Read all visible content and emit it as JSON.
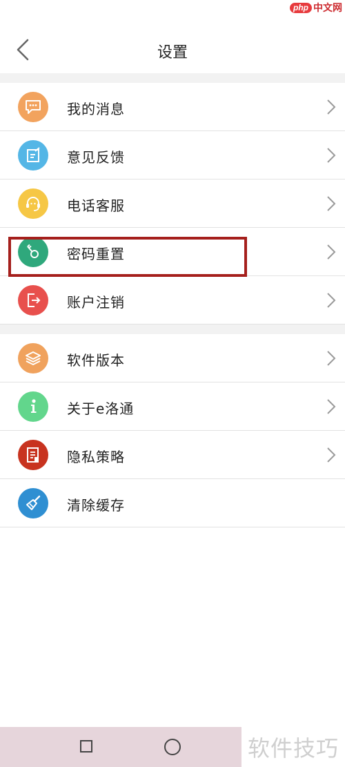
{
  "watermark_top": {
    "badge": "php",
    "text": "中文网"
  },
  "header": {
    "title": "设置"
  },
  "groups": [
    {
      "items": [
        {
          "label": "我的消息",
          "icon": "message-icon",
          "color": "#f2a35e"
        },
        {
          "label": "意见反馈",
          "icon": "feedback-icon",
          "color": "#54b6e6"
        },
        {
          "label": "电话客服",
          "icon": "headset-icon",
          "color": "#f6c745"
        },
        {
          "label": "密码重置",
          "icon": "key-icon",
          "color": "#2fa87c"
        },
        {
          "label": "账户注销",
          "icon": "logout-icon",
          "color": "#e8504d"
        }
      ]
    },
    {
      "items": [
        {
          "label": "软件版本",
          "icon": "layers-icon",
          "color": "#f0a25d"
        },
        {
          "label": "关于e洛通",
          "icon": "info-icon",
          "color": "#62d68c"
        },
        {
          "label": "隐私策略",
          "icon": "document-icon",
          "color": "#c8331f"
        },
        {
          "label": "清除缓存",
          "icon": "broom-icon",
          "color": "#2f8fd2"
        }
      ]
    }
  ],
  "highlight_color": "#a51f1c",
  "watermark_bottom": "软件技巧"
}
